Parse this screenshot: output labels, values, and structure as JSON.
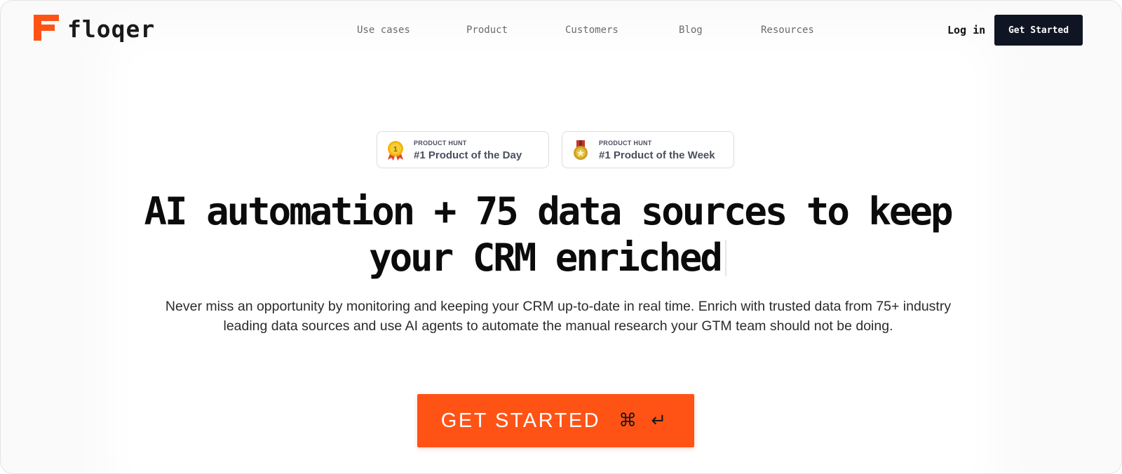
{
  "brand": {
    "name": "floqer",
    "accent_color": "#ff5316"
  },
  "nav": {
    "links": [
      "Use cases",
      "Product",
      "Customers",
      "Blog",
      "Resources"
    ],
    "login_label": "Log in",
    "cta_label": "Get Started",
    "cta_color": "#0f1523"
  },
  "badges": [
    {
      "kicker": "PRODUCT HUNT",
      "title": "#1 Product of the Day",
      "icon": "gold-medal-icon"
    },
    {
      "kicker": "PRODUCT HUNT",
      "title": "#1 Product of the Week",
      "icon": "bronze-medal-icon"
    }
  ],
  "hero": {
    "headline_line1": "AI automation + 75 data sources to keep",
    "headline_line2": "your CRM enriched",
    "subtext": "Never miss an opportunity by monitoring and keeping your CRM up-to-date in real time. Enrich with trusted data from 75+ industry leading data sources and use AI agents to automate the manual research your GTM team should not be doing.",
    "cta_label": "GET STARTED",
    "cta_shortcut": "⌘ ↵"
  }
}
